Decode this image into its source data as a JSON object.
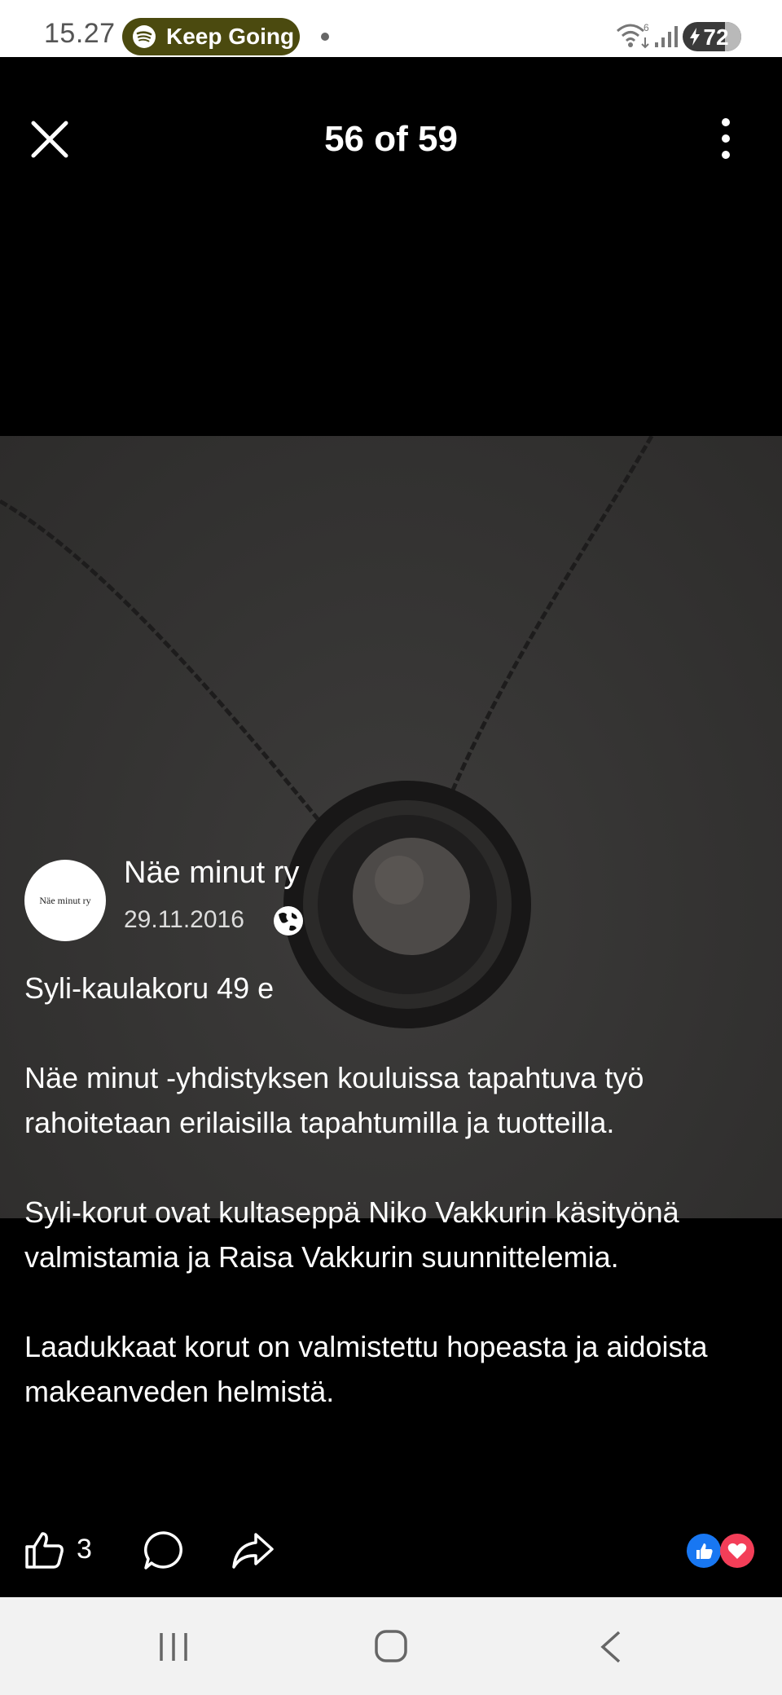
{
  "status_bar": {
    "time": "15.27",
    "media_label": "Keep Going",
    "battery_level": "72",
    "icons": [
      "spotify-icon",
      "wifi-icon",
      "signal-icon",
      "battery-charging-icon"
    ]
  },
  "header": {
    "counter": "56 of 59",
    "icons": [
      "close-icon",
      "more-vertical-icon"
    ]
  },
  "post": {
    "author": "Näe minut ry",
    "avatar_text": "Näe minut ry",
    "date": "29.11.2016",
    "audience_icon": "globe-icon",
    "paragraphs": [
      "Syli-kaulakoru 49 e",
      "Näe minut -yhdistyksen kouluissa tapahtuva työ rahoitetaan erilaisilla tapahtumilla ja tuotteilla.",
      "Syli-korut ovat kultaseppä Niko Vakkurin käsityönä valmistamia ja Raisa Vakkurin suunnittelemia.",
      "Laadukkaat korut on valmistettu hopeasta ja aidoista makeanveden helmistä."
    ]
  },
  "actions": {
    "like_count": "3",
    "icons": [
      "like-icon",
      "comment-icon",
      "share-icon",
      "reaction-like-icon",
      "reaction-love-icon"
    ]
  },
  "navbar": {
    "icons": [
      "recent-apps-icon",
      "home-icon",
      "back-icon"
    ]
  },
  "colors": {
    "background": "#000000",
    "media_pill": "#4b4a0f",
    "reaction_like": "#1877f2",
    "reaction_love": "#f33e58",
    "navbar": "#f2f2f2"
  }
}
